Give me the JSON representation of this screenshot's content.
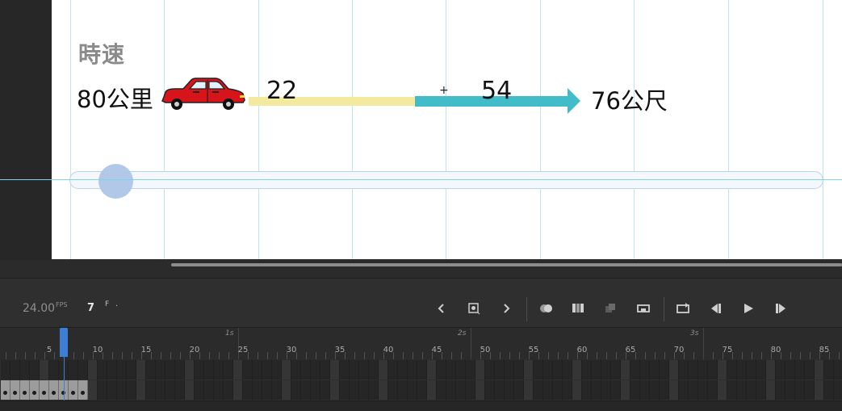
{
  "stage": {
    "heading": "時速",
    "speed_label": "80公里",
    "segment_a_value": "22",
    "segment_b_value": "54",
    "cross_marker": "+",
    "distance_label": "76公尺",
    "car_icon": "red-car",
    "segment_a_color": "#f3eaa0",
    "segment_b_color": "#43bcc9",
    "slider_track_color": "#f4f8fd",
    "slider_knob_color": "#b1c8e8",
    "slider_position": 0.06
  },
  "timeline": {
    "fps_value": "24.00",
    "fps_unit": "FPS",
    "current_frame": "7",
    "frame_unit": "F",
    "frame_suffix": "·",
    "accent_color": "#3e7fd6",
    "second_labels": [
      "1s",
      "2s",
      "3s"
    ],
    "frame_numbers": [
      "5",
      "10",
      "15",
      "20",
      "25",
      "30",
      "35",
      "40",
      "45",
      "50",
      "55",
      "60",
      "65",
      "70",
      "75",
      "80",
      "85"
    ],
    "controls": [
      {
        "name": "prev-keyframe-button",
        "icon": "chevron-left-icon"
      },
      {
        "name": "insert-keyframe-button",
        "icon": "keyframe-icon"
      },
      {
        "name": "next-keyframe-button",
        "icon": "chevron-right-icon"
      },
      {
        "name": "onion-skin-button",
        "icon": "onion-skin-icon"
      },
      {
        "name": "edit-multiple-frames-button",
        "icon": "multi-frame-icon"
      },
      {
        "name": "center-frame-button",
        "icon": "center-frame-icon"
      },
      {
        "name": "frame-range-button",
        "icon": "frame-range-icon"
      },
      {
        "name": "loop-button",
        "icon": "loop-icon"
      },
      {
        "name": "step-back-button",
        "icon": "step-back-icon"
      },
      {
        "name": "play-button",
        "icon": "play-icon"
      },
      {
        "name": "step-forward-button",
        "icon": "step-forward-icon"
      }
    ],
    "keyframe_count": 9
  }
}
